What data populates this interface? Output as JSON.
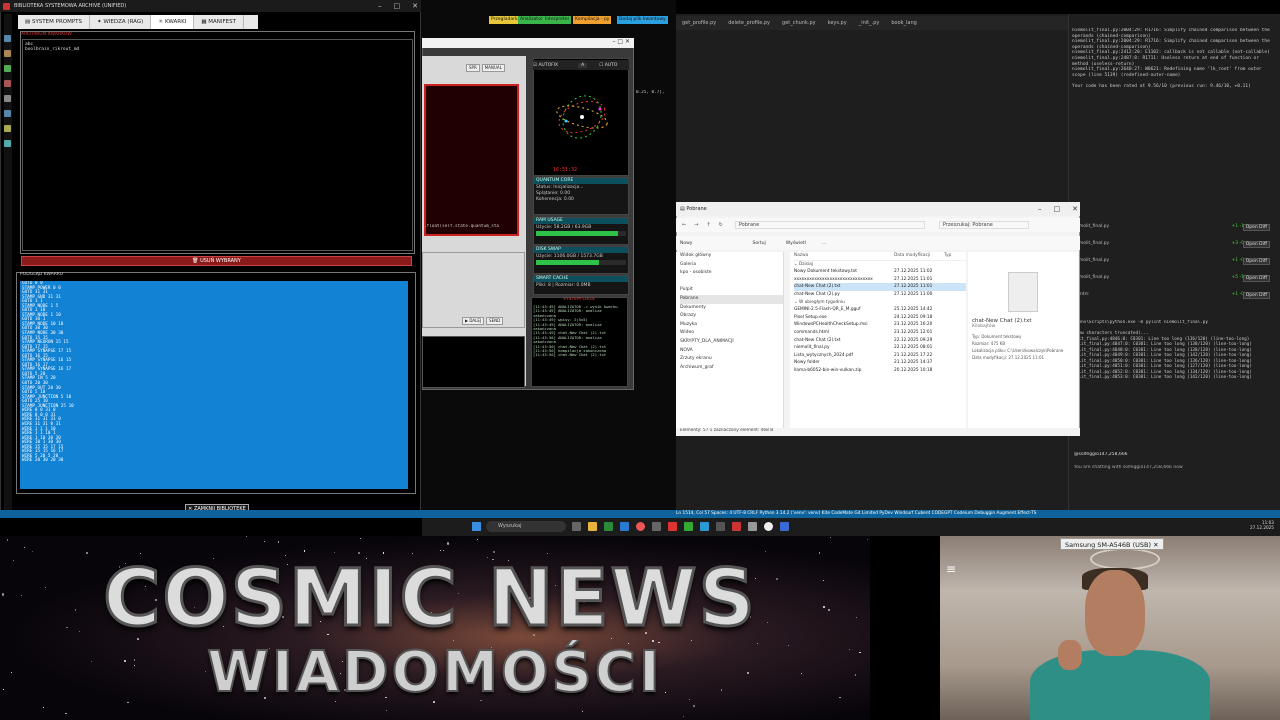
{
  "library": {
    "title": "BIBLIOTEKA SYSTEMOWA ARCHIVE (UNIFIED)",
    "tabs": [
      {
        "label": "SYSTEM PROMPTS"
      },
      {
        "label": "WIEDZA (RAG)"
      },
      {
        "label": "KWARKI"
      },
      {
        "label": "MANIFEST"
      }
    ],
    "archive_label": "ARCHIWUM KWARKÓW",
    "archive_items": [
      "abc",
      "boolbrain_rikrout_md"
    ],
    "delete_button": "USUŃ WYBRANY",
    "preview_label": "PODGLĄD KWARKU",
    "preview_lines": [
      "GOTO 0 0",
      "STAMP POWER 0 0",
      "GOTO 31 31",
      "STAMP GND 31 31",
      "GOTO 1 1",
      "STAMP NODE 1 5",
      "GOTO 1 10",
      "STAMP NODE 1 10",
      "GOTO 10 1",
      "STAMP NODE 10 10",
      "GOTO 30 30",
      "STAMP NODE 30 30",
      "GOTO 15 15",
      "STAMP NEURON 15 15",
      "GOTO 17 15",
      "STAMP SYNAPSE 17 15",
      "GOTO 16 15",
      "STAMP SYNAPSE 16 15",
      "GOTO 16 17",
      "STAMP SYNAPSE 16 17",
      "GOTO 5 20",
      "STAMP IN 5 20",
      "GOTO 20 30",
      "STAMP OUT 20 30",
      "GOTO 5 10",
      "STAMP JUNCTION 5 10",
      "GOTO 25 10",
      "STAMP JUNCTION 25 10",
      "WIRE 0 0 31 0",
      "WIRE 0 0 0 31",
      "WIRE 31 31 31 0",
      "WIRE 31 31 0 31",
      "WIRE 1 1 1 10",
      "WIRE 1 1 10 1",
      "WIRE 1 10 30 30",
      "WIRE 10 1 30 30",
      "WIRE 15 15 17 15",
      "WIRE 15 15 16 17",
      "WIRE 5 20 5 20",
      "WIRE 20 30 20 30"
    ],
    "close_button": "ZAMKNIJ BIBLIOTEKĘ"
  },
  "tags": [
    {
      "label": "Przegladarka",
      "color": "#e8c83a"
    },
    {
      "label": "Analizator",
      "color": "#3ab54a"
    },
    {
      "label": "Interpreter",
      "color": "#3ab54a"
    },
    {
      "label": "Kompilacja - py",
      "color": "#f0a030"
    },
    {
      "label": "Dodaj plik kwantowy",
      "color": "#2aa0e0"
    }
  ],
  "middle": {
    "buttons": [
      "SPR",
      "MANUAL"
    ],
    "autofix_label": "AUTOFIX",
    "auto_label": "AUTO",
    "clock": "16:51:32",
    "quantum": {
      "title": "QUANTUM CORE",
      "status": "Status: Inicjalizacja...",
      "entanglement": "Splątanie: 0.00",
      "coherence": "Koherencja: 0.00"
    },
    "ram": {
      "title": "RAM USAGE",
      "value": "Użycie: 58.2GB / 63.9GB",
      "percent": 91
    },
    "disk": {
      "title": "DISK SWAP",
      "value": "Użycie: 1106.0GB / 1573.7GB",
      "percent": 70
    },
    "cache": {
      "title": "SMART CACHE",
      "value": "Pliki: 8 | Rozmiar: 0.0MB"
    },
    "syslog_title": "SYSTEM LOGS",
    "syslog_lines": [
      "[11:43:49] ANALIZATOR -> wynik kwarku",
      "[11:43:49] ANALIZATOR: analiza zakończona",
      "[11:43:49] wpisy: 2(5x5)",
      "[11:43:49] ANALIZATOR: analiza zakończona",
      "[11:43:49] chat-New Chat (2).txt",
      "[11:43:50] ANALIZATOR: analiza zakończona",
      "[11:43:50] chat-New Chat (2).txt",
      "[11:43:50] kompilacja zakończona",
      "[11:43:50] chat-New Chat (2).txt"
    ],
    "next_button": "DALEJ",
    "send_button": "SEND",
    "code1": ".float(self.state.quantum_sta",
    "code2": "0.25, 0.7],"
  },
  "ide": {
    "tabs": [
      "get_profile.py",
      "delete_profile.py",
      "get_chunk.py",
      "keys.py",
      "_init_.py",
      "book_lang"
    ],
    "copilot_lines": [
      "niemolit_final.py:2004:29: R1716: Simplify chained comparison between the operands (chained-comparison)",
      "niemolit_final.py:2004:29: R1716: Simplify chained comparison between the operands (chained-comparison)",
      "niemolit_final.py:2412:20: E1102: callback is not callable (not-callable)",
      "niemolit_final.py:2487:8: R1711: Useless return at end of function or method (useless-return)",
      "niemolit_final.py:2640:27: W0621: Redefining name 'lk_root' from outer scope (line 5139) (redefined-outer-name)",
      "",
      "Your code has been rated at 9.56/10 (previous run: 9.46/10, +0.11)"
    ],
    "file_rows": [
      {
        "name": "niemolit_final.py",
        "add": "+1 -1",
        "btn": "Open Diff"
      },
      {
        "name": "niemolit_final.py",
        "add": "+3 -0",
        "btn": "Open Diff"
      },
      {
        "name": "niemolit_final.py",
        "add": "+1 -0",
        "btn": "Open Diff"
      },
      {
        "name": "niemolit_final.py",
        "add": "+5 -1",
        "btn": "Open Diff"
      },
      {
        "name": "pylintrc",
        "add": "+1 -0",
        "btn": "Open Diff"
      }
    ],
    "terminal_lines": [
      "venv\\Scripts\\python.exe -m pylint niemolit_final.py",
      "",
      "new characters truncated)...",
      "lit_final.py:4846:0: C0301: Line too long (136/120) (line-too-long)",
      "olit_final.py:4047:0: C0301: Line too long (138/120) (line-too-long)",
      "olit_final.py:4048:0: C0301: Line too long (138/120) (line-too-long)",
      "olit_final.py:4049:0: C0301: Line too long (142/120) (line-too-long)",
      "olit_final.py:4050:0: C0301: Line too long (136/120) (line-too-long)",
      "olit_final.py:4051:0: C0301: Line too long (127/120) (line-too-long)",
      "olit_final.py:4052:0: C0301: Line too long (134/120) (line-too-long)",
      "olit_final.py:4053:0: C0301: Line too long (142/120) (line-too-long)"
    ],
    "chat_user": "@solfeggio147,258,666",
    "chat_line": "You are chatting with solfeggio147,258,666 now",
    "status": "Ln 1514, Col 57   Spaces: 4   UTF-8   CRLF   Python   3.14.2 ('venv': venv)   Kite   CodeMate   Git Limited   PyDev   Windsurf   Cubent   CODEGPT   Codeium   Debuggin   Augment   Effect-TS"
  },
  "explorer": {
    "title": "Pobrane",
    "address": "Pobrane",
    "search": "Przeszukaj: Pobrane",
    "toolbar": [
      "Nowy",
      "Sortuj",
      "Wyświetl",
      "..."
    ],
    "nav": [
      "Widok główny",
      "Galeria",
      "kpo - osobiste",
      "",
      "Pulpit",
      "Pobrane",
      "Dokumenty",
      "Obrazy",
      "Muzyka",
      "Wideo",
      "SKRYPTY_DLA_ANIMACJI",
      "NOVA",
      "Zrzuty ekranu",
      "Archiwum_graf"
    ],
    "list_headers": [
      "Nazwa",
      "Data modyfikacji",
      "Typ"
    ],
    "groups": [
      "Dzisiaj",
      "W ubiegłym tygodniu"
    ],
    "files": [
      "Nowy Dokument tekstowy.txt",
      "xxxxxxxxxxxxxxxxxxxxxxxxxxxxxxx",
      "chat-New Chat (2).txt",
      "chat-New Chat (2).py",
      "GEMINI-2.5-Flash-QR_E_M.gguf",
      "Pixel Setup.exe",
      "WindowsPCHealthCheckSetup.msi",
      "commands.html",
      "chat-New Chat (2).txt",
      "niemolit_final.py",
      "Lista_wytycznych_2024.pdf",
      "Nowy folder",
      "llama-b6052-bin-win-vulkan.zip"
    ],
    "dates": [
      "27.12.2025 11:02",
      "27.12.2025 11:01",
      "27.12.2025 11:01",
      "27.12.2025 11:00",
      "25.12.2025 14:42",
      "24.12.2025 09:18",
      "23.12.2025 16:20",
      "23.12.2025 12:01",
      "22.12.2025 09:29",
      "22.12.2025 08:01",
      "21.12.2025 17:22",
      "21.12.2025 14:37",
      "20.12.2025 10:18"
    ],
    "detail_name": "chat-New Chat (2).txt",
    "detail_type": "Kilobajtów",
    "detail_rows": [
      "Typ: Dokument tekstowy",
      "Rozmiar: 475 KB",
      "Lokalizacja pliku: C:\\Users\\kowalczyk\\Pobrane",
      "Data modyfikacji: 27.12.2025 11:01"
    ],
    "status": "Elementy: 57   1 zaznaczony element: 468 B"
  },
  "taskbar": {
    "search_placeholder": "Wyszukaj",
    "time": "11:03",
    "date": "27.12.2025"
  },
  "banner": {
    "line1": "COSMIC NEWS",
    "line2": "WIADOMOŚCI"
  },
  "webcam": {
    "label": "Samsung SM-A546B (USB)"
  }
}
